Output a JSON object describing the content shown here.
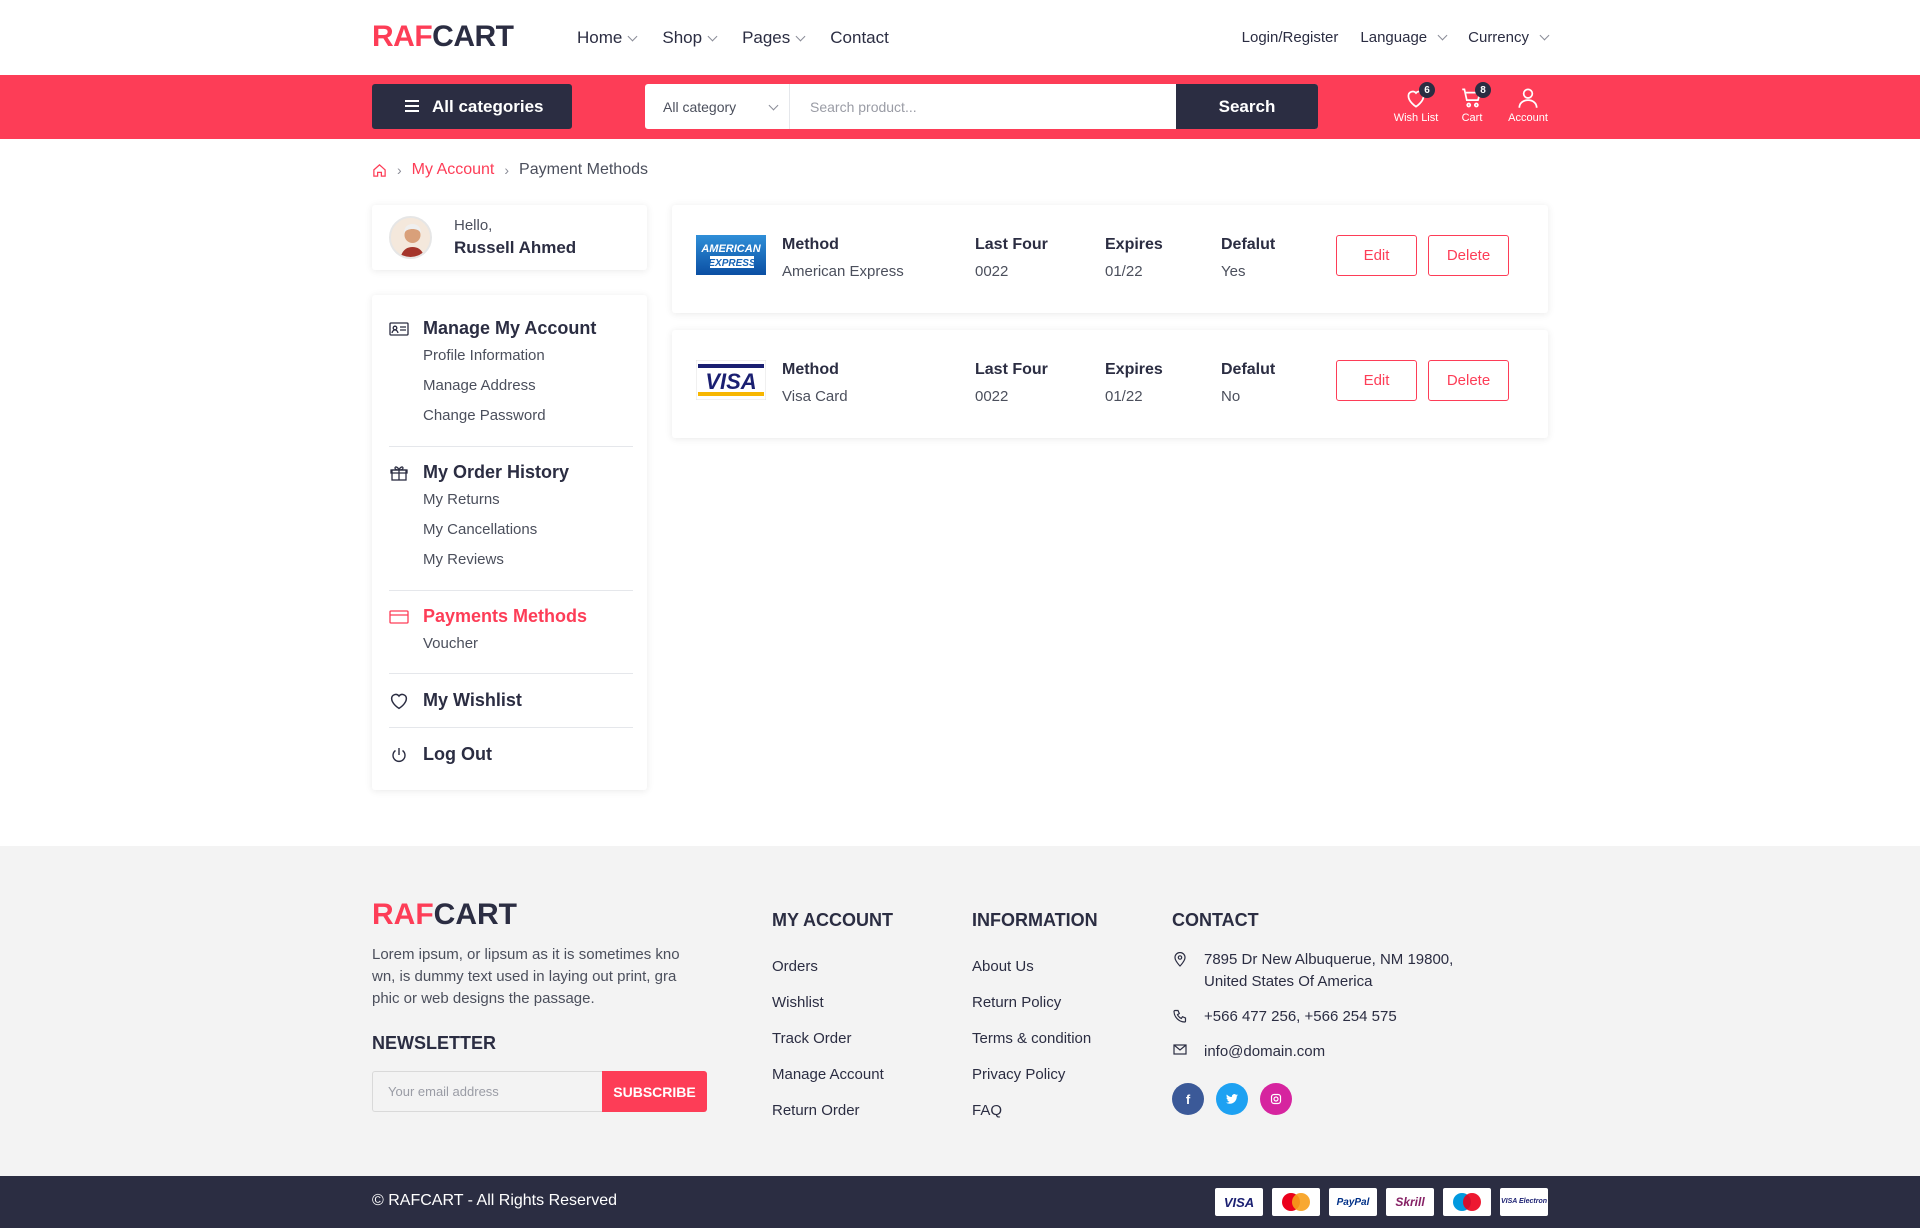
{
  "brand": {
    "part1": "RAF",
    "part2": "CART"
  },
  "nav": {
    "items": [
      "Home",
      "Shop",
      "Pages",
      "Contact"
    ]
  },
  "topright": {
    "login": "Login/Register",
    "language": "Language",
    "currency": "Currency"
  },
  "searchbar": {
    "all_categories": "All categories",
    "category_select": "All category",
    "placeholder": "Search product...",
    "search_button": "Search"
  },
  "header_icons": {
    "wishlist": {
      "label": "Wish List",
      "count": "6"
    },
    "cart": {
      "label": "Cart",
      "count": "8"
    },
    "account": {
      "label": "Account"
    }
  },
  "breadcrumb": {
    "parent": "My Account",
    "current": "Payment Methods"
  },
  "profile": {
    "greeting": "Hello,",
    "name": "Russell Ahmed"
  },
  "sidebar": {
    "manage": {
      "title": "Manage My Account",
      "items": [
        "Profile Information",
        "Manage Address",
        "Change Password"
      ]
    },
    "orders": {
      "title": "My Order History",
      "items": [
        "My Returns",
        "My Cancellations",
        "My Reviews"
      ]
    },
    "payments": {
      "title": "Payments Methods",
      "items": [
        "Voucher"
      ]
    },
    "wishlist": {
      "title": "My Wishlist"
    },
    "logout": {
      "title": "Log Out"
    }
  },
  "payment_headers": {
    "method": "Method",
    "last_four": "Last Four",
    "expires": "Expires",
    "default": "Defalut"
  },
  "payment_methods": [
    {
      "logo": "American Express",
      "method": "American Express",
      "last_four": "0022",
      "expires": "01/22",
      "default": "Yes",
      "edit": "Edit",
      "delete": "Delete"
    },
    {
      "logo": "VISA",
      "method": "Visa Card",
      "last_four": "0022",
      "expires": "01/22",
      "default": "No",
      "edit": "Edit",
      "delete": "Delete"
    }
  ],
  "footer": {
    "description": "Lorem ipsum, or lipsum as it is sometimes kno wn, is dummy text used in laying out print, gra phic or web designs the passage.",
    "newsletter_title": "NEWSLETTER",
    "email_placeholder": "Your email address",
    "subscribe": "SUBSCRIBE",
    "my_account": {
      "title": "MY ACCOUNT",
      "links": [
        "Orders",
        "Wishlist",
        "Track Order",
        "Manage Account",
        "Return Order"
      ]
    },
    "information": {
      "title": "INFORMATION",
      "links": [
        "About Us",
        "Return Policy",
        "Terms & condition",
        "Privacy Policy",
        "FAQ"
      ]
    },
    "contact": {
      "title": "CONTACT",
      "address_line1": "7895 Dr New Albuquerue, NM 19800,",
      "address_line2": "United States Of America",
      "phone": "+566 477 256, +566 254 575",
      "email": "info@domain.com"
    },
    "copyright": "© RAFCART - All Rights Reserved",
    "payment_cards": [
      "VISA",
      "MasterCard",
      "PayPal",
      "Skrill",
      "Maestro",
      "VISA Electron"
    ]
  },
  "colors": {
    "accent": "#fd3d57",
    "dark": "#2b2d42"
  }
}
